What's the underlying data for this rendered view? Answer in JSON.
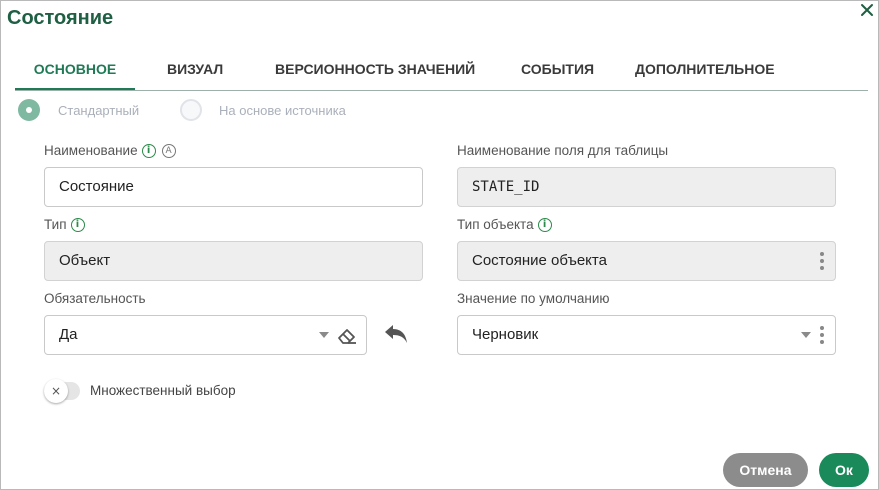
{
  "dialog": {
    "title": "Состояние"
  },
  "tabs": [
    {
      "label": "ОСНОВНОЕ"
    },
    {
      "label": "ВИЗУАЛ"
    },
    {
      "label": "ВЕРСИОННОСТЬ ЗНАЧЕНИЙ"
    },
    {
      "label": "СОБЫТИЯ"
    },
    {
      "label": "ДОПОЛНИТЕЛЬНОЕ"
    }
  ],
  "mode": {
    "standard_label": "Стандартный",
    "source_label": "На основе источника"
  },
  "fields": {
    "name": {
      "label": "Наименование",
      "value": "Состояние"
    },
    "table_field": {
      "label": "Наименование поля для таблицы",
      "value": "STATE_ID"
    },
    "type": {
      "label": "Тип",
      "value": "Объект"
    },
    "object_type": {
      "label": "Тип объекта",
      "value": "Состояние объекта"
    },
    "required": {
      "label": "Обязательность",
      "value": "Да"
    },
    "default": {
      "label": "Значение по умолчанию",
      "value": "Черновик"
    }
  },
  "multiple": {
    "label": "Множественный выбор"
  },
  "footer": {
    "cancel_label": "Отмена",
    "ok_label": "Ок"
  },
  "colors": {
    "accent": "#1f7a55",
    "ok_button": "#1a8a5a",
    "cancel_button": "#8c8c8c"
  },
  "icons": {
    "close": "close-icon",
    "info": "info-icon",
    "auto": "auto-icon",
    "eraser": "eraser-icon",
    "undo": "undo-icon",
    "kebab": "kebab-icon",
    "dropdown": "chevron-down-icon",
    "toggle_off": "x-icon"
  }
}
